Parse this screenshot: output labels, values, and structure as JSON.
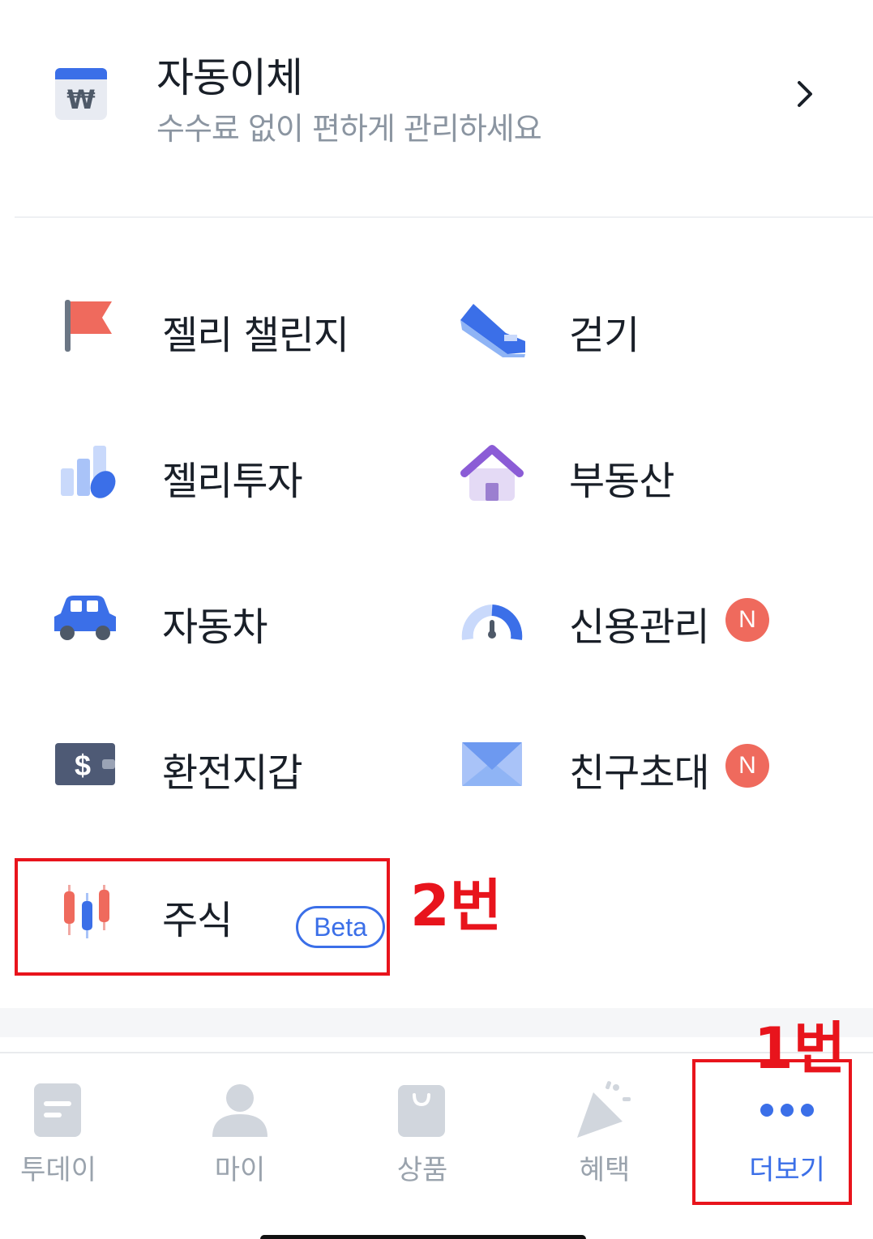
{
  "transfer": {
    "title": "자동이체",
    "subtitle": "수수료 없이 편하게 관리하세요",
    "icon": "won-calendar-icon"
  },
  "menu": [
    {
      "label": "젤리 챌린지",
      "icon": "flag-icon"
    },
    {
      "label": "걷기",
      "icon": "sneaker-icon"
    },
    {
      "label": "젤리투자",
      "icon": "jelly-chart-icon"
    },
    {
      "label": "부동산",
      "icon": "house-icon"
    },
    {
      "label": "자동차",
      "icon": "car-icon"
    },
    {
      "label": "신용관리",
      "icon": "gauge-icon",
      "badge": "N"
    },
    {
      "label": "환전지갑",
      "icon": "dollar-wallet-icon"
    },
    {
      "label": "친구초대",
      "icon": "envelope-icon",
      "badge": "N"
    },
    {
      "label": "주식",
      "icon": "candlestick-icon",
      "tag": "Beta"
    }
  ],
  "annotations": {
    "stock": "2번",
    "more": "1번"
  },
  "tabs": [
    {
      "label": "투데이",
      "icon": "today-icon"
    },
    {
      "label": "마이",
      "icon": "person-icon"
    },
    {
      "label": "상품",
      "icon": "shopping-bag-icon"
    },
    {
      "label": "혜택",
      "icon": "party-popper-icon"
    },
    {
      "label": "더보기",
      "icon": "more-dots-icon",
      "active": true
    }
  ],
  "colors": {
    "accent": "#3b6fe8",
    "badge": "#ef6a5d",
    "annotation": "#e8141c",
    "inactive_tab": "#9aa3ad"
  }
}
